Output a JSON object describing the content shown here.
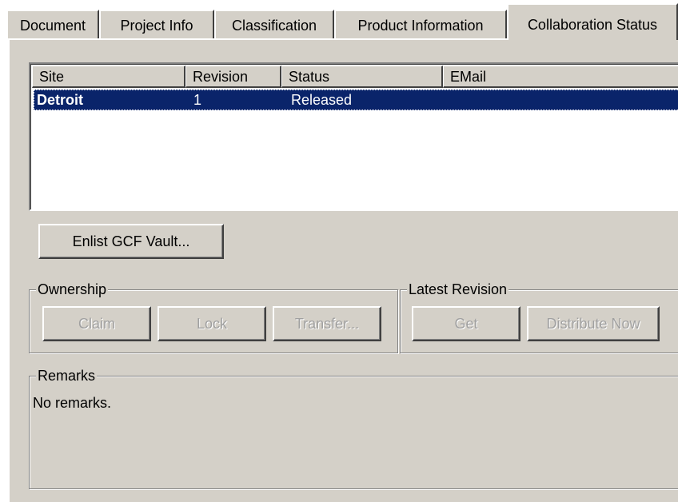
{
  "tabs": [
    {
      "label": "Document"
    },
    {
      "label": "Project Info"
    },
    {
      "label": "Classification"
    },
    {
      "label": "Product Information"
    },
    {
      "label": "Collaboration Status",
      "active": true
    }
  ],
  "sites_list": {
    "columns": [
      "Site",
      "Revision",
      "Status",
      "EMail"
    ],
    "rows": [
      {
        "site": "Detroit",
        "revision": "1",
        "status": "Released",
        "email": "",
        "selected": true
      }
    ]
  },
  "enlist_button": {
    "label": "Enlist GCF Vault..."
  },
  "ownership": {
    "title": "Ownership",
    "claim_label": "Claim",
    "lock_label": "Lock",
    "transfer_label": "Transfer..."
  },
  "latest_revision": {
    "title": "Latest Revision",
    "get_label": "Get",
    "distribute_label": "Distribute Now"
  },
  "remarks": {
    "title": "Remarks",
    "text": "No remarks."
  },
  "colors": {
    "face": "#d4d0c8",
    "selection": "#0a246a",
    "disabled_text": "#a0a0a0"
  }
}
